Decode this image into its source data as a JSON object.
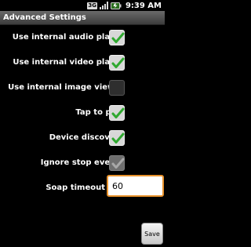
{
  "status_bar": {
    "network_label": "3G",
    "time": "9:39 AM"
  },
  "title": "Advanced Settings",
  "settings": [
    {
      "label": "Use internal audio player",
      "checked": true,
      "enabled": true
    },
    {
      "label": "Use internal video player",
      "checked": true,
      "enabled": true
    },
    {
      "label": "Use internal image viewer",
      "checked": false,
      "enabled": true
    },
    {
      "label": "Tap to play",
      "checked": true,
      "enabled": true
    },
    {
      "label": "Device discovery",
      "checked": true,
      "enabled": true
    },
    {
      "label": "Ignore stop events",
      "checked": true,
      "enabled": false
    }
  ],
  "soap_timeout": {
    "label": "Soap timeout",
    "value": "60"
  },
  "save_button": {
    "label": "Save"
  },
  "colors": {
    "check": "#2fa82f",
    "input_focus": "#e8922c"
  }
}
